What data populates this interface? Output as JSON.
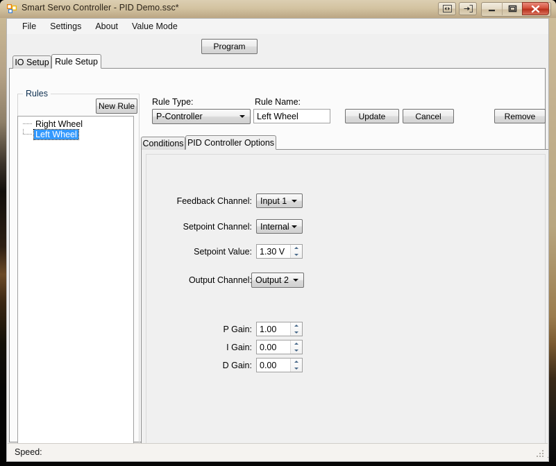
{
  "window": {
    "title": "Smart Servo Controller - PID Demo.ssc*",
    "icon": "app-icon",
    "controls": {
      "extra1": "panel-toggle-icon",
      "extra2": "detach-icon",
      "minimize": "minimize-icon",
      "maximize": "maximize-icon",
      "close": "close-icon"
    }
  },
  "menu": {
    "items": [
      {
        "label": "File"
      },
      {
        "label": "Settings"
      },
      {
        "label": "About"
      },
      {
        "label": "Value Mode"
      }
    ]
  },
  "toolbar": {
    "program_label": "Program"
  },
  "outer_tabs": [
    {
      "label": "IO Setup",
      "active": false
    },
    {
      "label": "Rule Setup",
      "active": true
    }
  ],
  "rules_group": {
    "legend": "Rules",
    "new_rule_label": "New Rule",
    "tree": [
      {
        "label": "Right Wheel",
        "selected": false
      },
      {
        "label": "Left Wheel",
        "selected": true
      }
    ]
  },
  "rule_header": {
    "rule_type_label": "Rule Type:",
    "rule_type_value": "P-Controller",
    "rule_name_label": "Rule Name:",
    "rule_name_value": "Left Wheel",
    "update_label": "Update",
    "cancel_label": "Cancel",
    "remove_label": "Remove"
  },
  "inner_tabs": [
    {
      "label": "Conditions",
      "active": false
    },
    {
      "label": "PID Controller Options",
      "active": true
    }
  ],
  "pid_options": {
    "feedback_channel_label": "Feedback Channel:",
    "feedback_channel_value": "Input 1",
    "setpoint_channel_label": "Setpoint Channel:",
    "setpoint_channel_value": "Internal",
    "setpoint_value_label": "Setpoint Value:",
    "setpoint_value_value": "1.30 V",
    "output_channel_label": "Output Channel:",
    "output_channel_value": "Output 2",
    "p_gain_label": "P Gain:",
    "p_gain_value": "1.00",
    "i_gain_label": "I Gain:",
    "i_gain_value": "0.00",
    "d_gain_label": "D Gain:",
    "d_gain_value": "0.00"
  },
  "statusbar": {
    "speed_label": "Speed:"
  },
  "colors": {
    "title_bar": "#d3c3a1",
    "client_bg": "#f0f0f0",
    "tab_page_bg": "#fbfbfb",
    "selection_blue": "#3399ff",
    "close_red": "#c4422c",
    "accent_icon_orange": "#e8820c"
  }
}
